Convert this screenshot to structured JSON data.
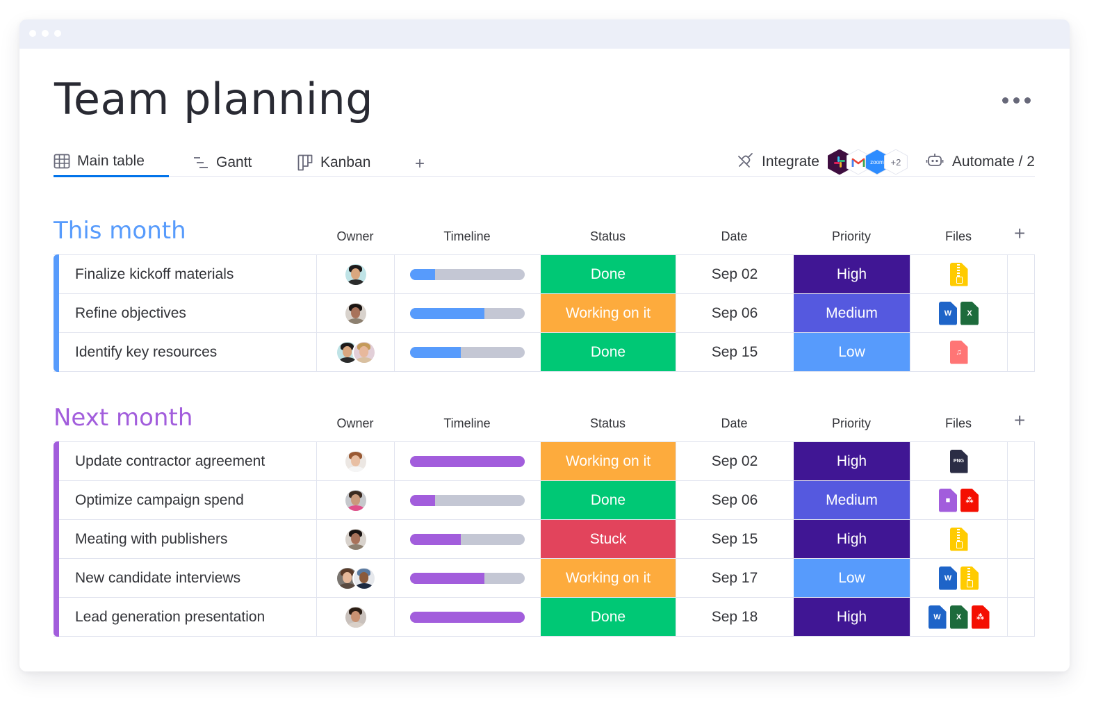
{
  "window": {
    "title_dots": 3
  },
  "page": {
    "title": "Team planning"
  },
  "tabs": [
    {
      "label": "Main table",
      "icon": "table-icon",
      "active": true
    },
    {
      "label": "Gantt",
      "icon": "gantt-icon",
      "active": false
    },
    {
      "label": "Kanban",
      "icon": "kanban-icon",
      "active": false
    }
  ],
  "tab_add_label": "+",
  "actions": {
    "integrate_label": "Integrate",
    "integrations": [
      "slack",
      "gmail",
      "zoom"
    ],
    "integrations_more": "+2",
    "zoom_text": "zoom",
    "automate_label": "Automate / 2"
  },
  "columns": {
    "owner": "Owner",
    "timeline": "Timeline",
    "status": "Status",
    "date": "Date",
    "priority": "Priority",
    "files": "Files",
    "add": "+"
  },
  "colors": {
    "status": {
      "Done": "#00c875",
      "Working on it": "#fdab3d",
      "Stuck": "#e2445c"
    },
    "priority": {
      "High": "#401694",
      "Medium": "#5559df",
      "Low": "#579bfc"
    },
    "this_month": "#579bfc",
    "next_month": "#a25ddc"
  },
  "groups": [
    {
      "title": "This month",
      "color": "#579bfc",
      "rows": [
        {
          "name": "Finalize kickoff materials",
          "owners": [
            "man-asian"
          ],
          "timeline": 0.22,
          "status": "Done",
          "date": "Sep 02",
          "priority": "High",
          "files": [
            "zip"
          ]
        },
        {
          "name": "Refine objectives",
          "owners": [
            "woman-dark-hair"
          ],
          "timeline": 0.65,
          "status": "Working on it",
          "date": "Sep 06",
          "priority": "Medium",
          "files": [
            "word",
            "excel"
          ]
        },
        {
          "name": "Identify key resources",
          "owners": [
            "man-asian",
            "woman-blonde"
          ],
          "timeline": 0.44,
          "status": "Done",
          "date": "Sep 15",
          "priority": "Low",
          "files": [
            "audio"
          ]
        }
      ]
    },
    {
      "title": "Next month",
      "color": "#a25ddc",
      "rows": [
        {
          "name": "Update contractor agreement",
          "owners": [
            "woman-red-hair"
          ],
          "timeline": 1.0,
          "status": "Working on it",
          "date": "Sep 02",
          "priority": "High",
          "files": [
            "png"
          ]
        },
        {
          "name": "Optimize campaign spend",
          "owners": [
            "man-beard"
          ],
          "timeline": 0.22,
          "status": "Done",
          "date": "Sep 06",
          "priority": "Medium",
          "files": [
            "video",
            "pdf"
          ]
        },
        {
          "name": "Meating with publishers",
          "owners": [
            "woman-dark-hair"
          ],
          "timeline": 0.44,
          "status": "Stuck",
          "date": "Sep 15",
          "priority": "High",
          "files": [
            "zip"
          ]
        },
        {
          "name": "New candidate interviews",
          "owners": [
            "woman-brown-hair",
            "man-cap"
          ],
          "timeline": 0.65,
          "status": "Working on it",
          "date": "Sep 17",
          "priority": "Low",
          "files": [
            "word",
            "zip"
          ]
        },
        {
          "name": "Lead generation presentation",
          "owners": [
            "man-smile"
          ],
          "timeline": 1.0,
          "status": "Done",
          "date": "Sep 18",
          "priority": "High",
          "files": [
            "word",
            "excel",
            "pdf"
          ]
        }
      ]
    }
  ],
  "file_labels": {
    "word": "W",
    "excel": "X",
    "png": "PNG"
  }
}
